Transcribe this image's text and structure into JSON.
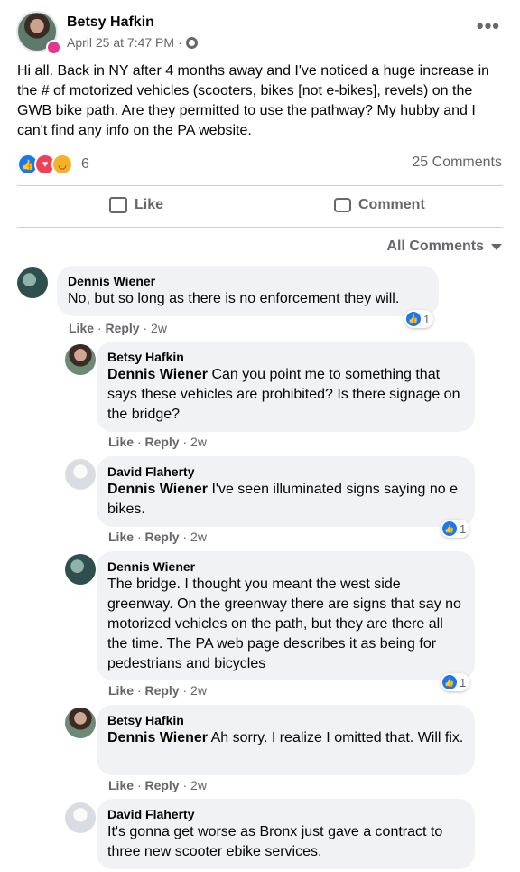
{
  "post": {
    "author": "Betsy Hafkin",
    "date": "April 25 at 7:47 PM",
    "audience_icon": "friends-icon",
    "more": "•••",
    "text": "Hi all. Back in NY after 4 months away and I've noticed a huge increase in the # of motorized vehicles (scooters, bikes [not e-bikes], revels) on the GWB bike path. Are they permitted to use the pathway? My hubby and I can't find any info on the PA website.",
    "reaction_count": "6",
    "comments_count": "25 Comments",
    "like_label": "Like",
    "comment_label": "Comment",
    "sort_label": "All Comments"
  },
  "comments": [
    {
      "author": "Dennis Wiener",
      "mention": "",
      "text": "No, but so long as there is no enforcement they will.",
      "like": "Like",
      "reply": "Reply",
      "age": "2w",
      "reactions": "1"
    },
    {
      "author": "Betsy Hafkin",
      "mention": "Dennis Wiener",
      "text": " Can you point me to something that says these vehicles are prohibited? Is there signage on the bridge?",
      "like": "Like",
      "reply": "Reply",
      "age": "2w",
      "reactions": ""
    },
    {
      "author": "David Flaherty",
      "mention": "Dennis Wiener",
      "text": " I've seen illuminated signs saying no e bikes.",
      "like": "Like",
      "reply": "Reply",
      "age": "2w",
      "reactions": "1"
    },
    {
      "author": "Dennis Wiener",
      "mention": "",
      "text": "The bridge. I thought you meant the west side greenway. On the greenway there are signs that say no motorized vehicles on the path, but they are there all the time. The PA web page describes it as being for pedestrians and bicycles",
      "like": "Like",
      "reply": "Reply",
      "age": "2w",
      "reactions": "1"
    },
    {
      "author": "Betsy Hafkin",
      "mention": "Dennis Wiener",
      "text": " Ah sorry. I realize I omitted that. Will fix.",
      "like": "Like",
      "reply": "Reply",
      "age": "2w",
      "reactions": ""
    },
    {
      "author": "David Flaherty",
      "mention": "",
      "text": "It's gonna get worse as Bronx just gave a contract to three new scooter ebike services.",
      "like": "",
      "reply": "",
      "age": "",
      "reactions": ""
    }
  ],
  "colors": {
    "accent": "#1877f2",
    "bubble": "#f0f2f5",
    "muted": "#65676b"
  }
}
